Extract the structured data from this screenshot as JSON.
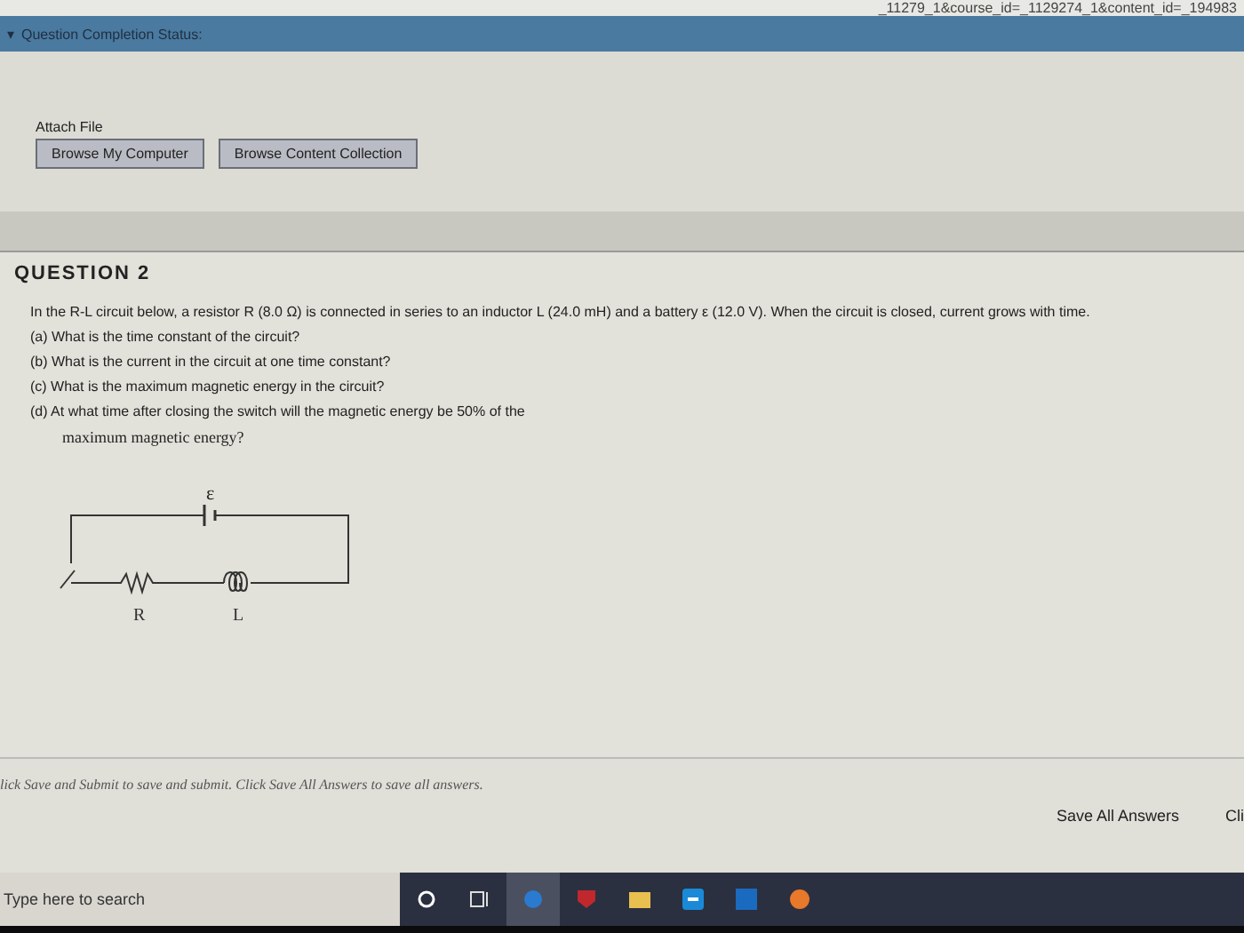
{
  "address_bar": {
    "url": "_11279_1&course_id=_1129274_1&content_id=_194983"
  },
  "status_bar": {
    "toggle": "▾",
    "label": "Question Completion Status:"
  },
  "attach": {
    "label": "Attach File",
    "buttons": [
      "Browse My Computer",
      "Browse Content Collection"
    ]
  },
  "question": {
    "title": "QUESTION 2",
    "intro": "In the R-L circuit below, a resistor R (8.0 Ω)  is connected in series to an inductor L (24.0 mH) and a battery ε (12.0 V). When the circuit is closed, current grows with time.",
    "parts": [
      "(a) What is the time constant of the circuit?",
      "(b) What is the current in the circuit at one time constant?",
      "(c) What is the maximum magnetic energy in the circuit?",
      "(d) At what time after closing the switch will the magnetic energy be 50% of the"
    ],
    "continuation": "maximum magnetic energy?",
    "circuit": {
      "battery_label": "ε",
      "resistor_label": "R",
      "inductor_label": "L"
    }
  },
  "footer": {
    "instruction": "lick Save and Submit to save and submit. Click Save All Answers to save all answers.",
    "buttons": [
      "Save All Answers",
      "Cli"
    ]
  },
  "taskbar": {
    "search_placeholder": "Type here to search"
  }
}
